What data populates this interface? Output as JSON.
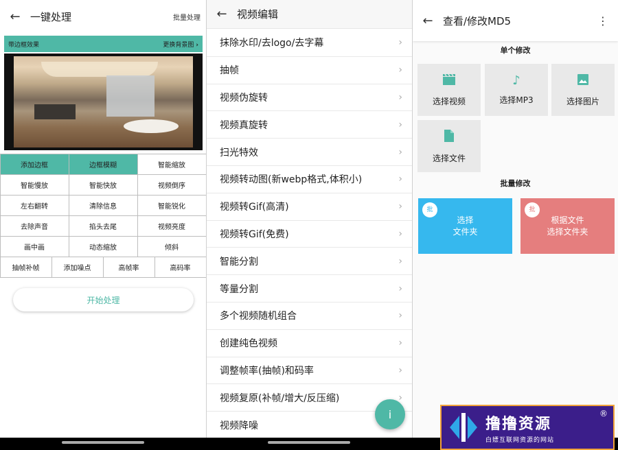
{
  "colors": {
    "accent": "#4fb8a6",
    "blue": "#36b8ee",
    "red": "#e57e7e",
    "watermark_bg": "#3b1e8a"
  },
  "p1": {
    "title": "一键处理",
    "batch": "批量处理",
    "banner_left": "带边框效果",
    "banner_right": "更换背景图",
    "rows": [
      [
        "添加边框",
        "边框模糊",
        "智能缩放"
      ],
      [
        "智能慢放",
        "智能快放",
        "视频倒序"
      ],
      [
        "左右翻转",
        "清除信息",
        "智能锐化"
      ],
      [
        "去除声音",
        "掐头去尾",
        "视频亮度"
      ],
      [
        "画中画",
        "动态缩放",
        "倾斜"
      ],
      [
        "抽帧补帧",
        "添加噪点",
        "高帧率",
        "高码率"
      ]
    ],
    "start": "开始处理"
  },
  "p2": {
    "title": "视频编辑",
    "items": [
      "抹除水印/去logo/去字幕",
      "抽帧",
      "视频伪旋转",
      "视频真旋转",
      "扫光特效",
      "视频转动图(新webp格式,体积小)",
      "视频转Gif(高清)",
      "视频转Gif(免费)",
      "智能分割",
      "等量分割",
      "多个视频随机组合",
      "创建纯色视频",
      "调整帧率(抽帧)和码率",
      "视频复原(补帧/增大/反压缩)",
      "视频降噪"
    ],
    "fab": "i"
  },
  "p3": {
    "title": "查看/修改MD5",
    "single_header": "单个修改",
    "tiles": [
      {
        "label": "选择视频",
        "icon": "clapperboard-icon"
      },
      {
        "label": "选择MP3",
        "icon": "music-note-icon"
      },
      {
        "label": "选择图片",
        "icon": "image-icon"
      },
      {
        "label": "选择文件",
        "icon": "file-icon"
      }
    ],
    "batch_header": "批量修改",
    "batch_left": {
      "badge": "批",
      "line1": "选择",
      "line2": "文件夹"
    },
    "batch_right": {
      "badge": "批",
      "line1": "根据文件",
      "line2": "选择文件夹"
    }
  },
  "watermark": {
    "title": "撸撸资源",
    "reg": "®",
    "subtitle": "白嫖互联网资源的网站"
  }
}
